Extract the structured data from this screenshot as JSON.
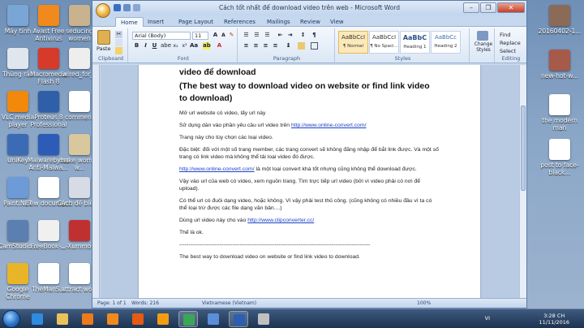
{
  "desktop": {
    "left_icons": [
      {
        "label": "Máy tính",
        "color": "#7aa6d6"
      },
      {
        "label": "Avast Free Antivirus",
        "color": "#f08a1c"
      },
      {
        "label": "seducing women",
        "color": "#c9b28e"
      },
      {
        "label": "Thùng rác",
        "color": "#dfe6ee"
      },
      {
        "label": "Macromedia Flash 8",
        "color": "#d63a2a"
      },
      {
        "label": "wired_for_s",
        "color": "#eeeeee"
      },
      {
        "label": "VLC media player",
        "color": "#f2880c"
      },
      {
        "label": "Proteus 8 Professional",
        "color": "#2f5fa8"
      },
      {
        "label": "comment",
        "color": "#ffffff"
      },
      {
        "label": "UniKey",
        "color": "#3b6bb5"
      },
      {
        "label": "Malwarebytes Anti-Malwa...",
        "color": "#2c5cb8"
      },
      {
        "label": "make women w...",
        "color": "#d9c79e"
      },
      {
        "label": "Paint.NET",
        "color": "#6d9bd8"
      },
      {
        "label": "new document",
        "color": "#ffffff"
      },
      {
        "label": "Cách để biết...",
        "color": "#d6dbe6"
      },
      {
        "label": "CamStudio...",
        "color": "#5a7fb0"
      },
      {
        "label": "FreeBook-...",
        "color": "#f0f0f0"
      },
      {
        "label": "...-Xummo-...",
        "color": "#c03030"
      },
      {
        "label": "Google Chrome",
        "color": "#e8b428"
      },
      {
        "label": "TheManS...",
        "color": "#ffffff"
      },
      {
        "label": "attract wo...",
        "color": "#ffffff"
      }
    ],
    "right_icons": [
      {
        "label": "20160402-1...",
        "color": "#8c6a58"
      },
      {
        "label": "new-hot-w...",
        "color": "#a65a4a"
      },
      {
        "label": "the modern man",
        "color": "#ffffff"
      },
      {
        "label": "post to face-black...",
        "color": "#ffffff"
      }
    ]
  },
  "word": {
    "title": "Cách tốt nhất để download video trên web  -  Microsoft Word",
    "tabs": [
      "Home",
      "Insert",
      "Page Layout",
      "References",
      "Mailings",
      "Review",
      "View"
    ],
    "active_tab": "Home",
    "ribbon": {
      "clipboard": {
        "label": "Clipboard",
        "paste": "Paste"
      },
      "font": {
        "label": "Font",
        "font_name": "Arial (Body)",
        "font_size": "11"
      },
      "paragraph": {
        "label": "Paragraph"
      },
      "styles": {
        "label": "Styles",
        "items": [
          {
            "sample": "AaBbCcI",
            "name": "¶ Normal"
          },
          {
            "sample": "AaBbCcI",
            "name": "¶ No Spaci..."
          },
          {
            "sample": "AaBbC",
            "name": "Heading 1"
          },
          {
            "sample": "AaBbCc",
            "name": "Heading 2"
          }
        ],
        "change_styles": "Change Styles"
      },
      "editing": {
        "label": "Editing",
        "find": "Find",
        "replace": "Replace",
        "select": "Select"
      }
    },
    "document": {
      "heading_partial": "video để download",
      "heading_en": "(The best way to download  video on website  or find link video to download)",
      "paragraphs": [
        {
          "text": "Mở url website có video, lấy url này",
          "link": ""
        },
        {
          "text": "Sử dụng dàn vào phần yêu cầu url video trên ",
          "link": "http://www.online-convert.com/"
        },
        {
          "text": "Trang này cho tùy chọn các loại video.",
          "link": ""
        },
        {
          "text": "Đặc biệt: đối với một số trang member, các trang convert sẽ không đăng nhập để bắt link được. Và một số trang có link video mà không thể tải loại video đó được.",
          "link": ""
        },
        {
          "text": "",
          "link": "http://www.online-convert.com/",
          "after": " là một loại convert khá tốt nhưng cũng không thể download được."
        },
        {
          "text": "Vậy vào url của web có video, xem nguồn trang. Tìm trực tiếp url video (bởi vì video phải có nơi để upload).",
          "link": ""
        },
        {
          "text": "Có thể url có đuôi dạng video, hoặc không. Vì vậy phải test thủ công. (cũng không có nhiều đầu vì ta có thể loại trừ được các file dạng văn bản....)",
          "link": ""
        },
        {
          "text": "Dùng url video này cho vào ",
          "link": "http://www.clipconverter.cc/"
        },
        {
          "text": "Thế là ok.",
          "link": ""
        },
        {
          "text": "--------------------------------------------------------------------------------------------------------",
          "link": ""
        },
        {
          "text": "The best way to download video on website or find link video to download.",
          "link": ""
        }
      ]
    },
    "status": {
      "page": "Page: 1 of 1",
      "words": "Words: 216",
      "language": "Vietnamese (Vietnam)",
      "zoom": "100%"
    }
  },
  "taskbar": {
    "lang": "VI",
    "time": "3:28 CH",
    "date": "11/11/2016",
    "apps": [
      {
        "name": "ie",
        "color": "#2f8be0",
        "open": false
      },
      {
        "name": "explorer",
        "color": "#e9c35a",
        "open": false
      },
      {
        "name": "media-player",
        "color": "#ee7a1a",
        "open": false
      },
      {
        "name": "vlc",
        "color": "#f08a1c",
        "open": false
      },
      {
        "name": "firefox",
        "color": "#e55b13",
        "open": false
      },
      {
        "name": "avast",
        "color": "#f39c12",
        "open": false
      },
      {
        "name": "chrome",
        "color": "#3aa757",
        "open": true
      },
      {
        "name": "paint",
        "color": "#5a8ed8",
        "open": false
      },
      {
        "name": "word",
        "color": "#2b5fb4",
        "open": true
      },
      {
        "name": "xbox",
        "color": "#c0c0c0",
        "open": false
      }
    ]
  }
}
